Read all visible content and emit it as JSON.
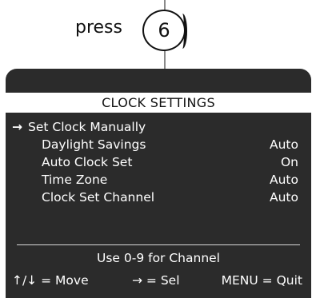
{
  "instruction": {
    "press_label": "press",
    "key": "6"
  },
  "screen": {
    "title": "CLOCK SETTINGS",
    "cursor_glyph": "→",
    "items": [
      {
        "label": "Set Clock Manually",
        "value": ""
      },
      {
        "label": "Daylight Savings",
        "value": "Auto"
      },
      {
        "label": "Auto Clock Set",
        "value": "On"
      },
      {
        "label": "Time Zone",
        "value": "Auto"
      },
      {
        "label": "Clock Set Channel",
        "value": "Auto"
      }
    ],
    "hint": "Use 0-9 for Channel",
    "controls": {
      "move": "↑/↓ = Move",
      "select": "→ = Sel",
      "quit": "MENU = Quit"
    }
  }
}
